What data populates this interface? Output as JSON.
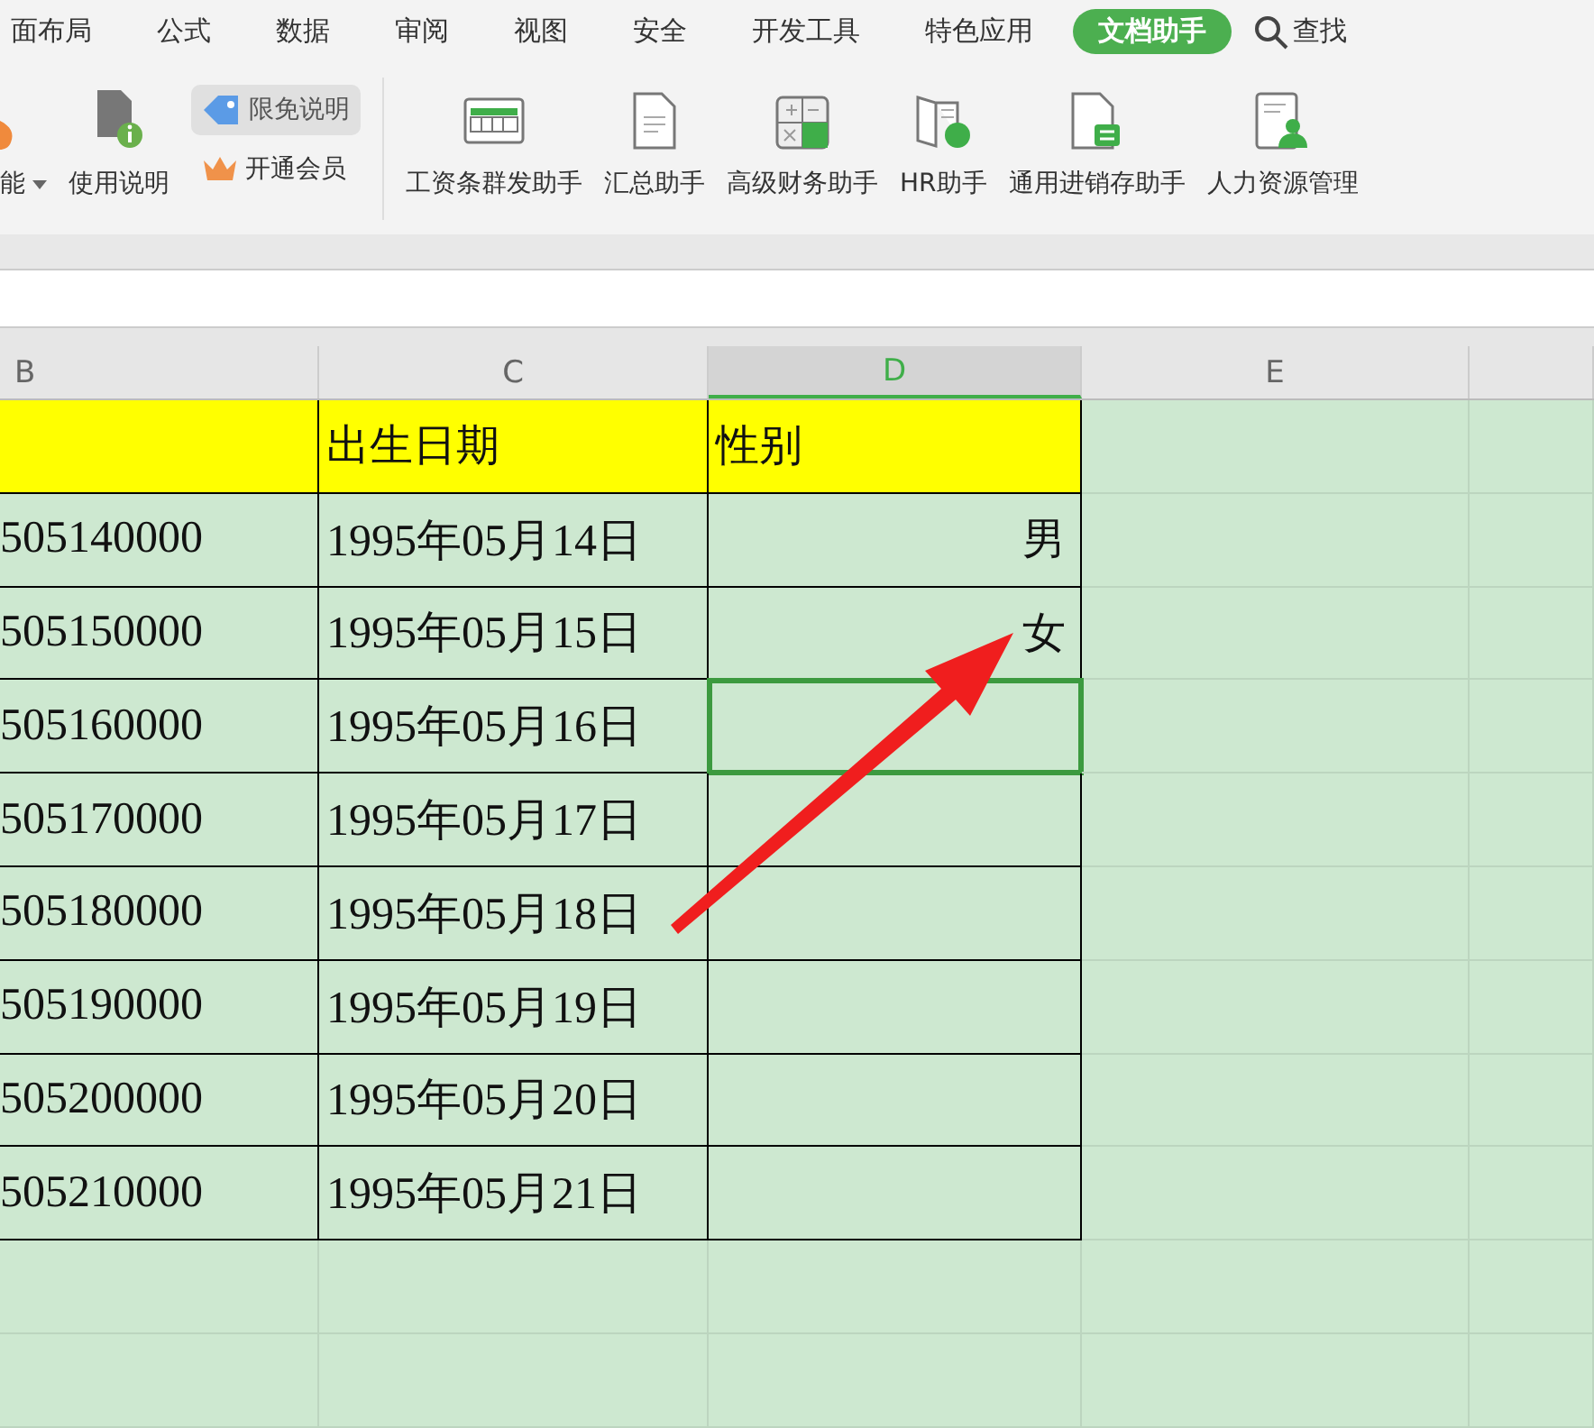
{
  "menu_tabs": [
    {
      "label": "面布局",
      "selected": false
    },
    {
      "label": "公式",
      "selected": false
    },
    {
      "label": "数据",
      "selected": false
    },
    {
      "label": "审阅",
      "selected": false
    },
    {
      "label": "视图",
      "selected": false
    },
    {
      "label": "安全",
      "selected": false
    },
    {
      "label": "开发工具",
      "selected": false
    },
    {
      "label": "特色应用",
      "selected": false
    },
    {
      "label": "文档助手",
      "selected": true
    }
  ],
  "search": {
    "label": "查找"
  },
  "ribbon": {
    "left": [
      {
        "kind": "partial",
        "label": "能"
      },
      {
        "kind": "help",
        "label": "使用说明"
      }
    ],
    "promo": [
      {
        "kind": "tag",
        "label": "限免说明"
      },
      {
        "kind": "crown",
        "label": "开通会员"
      }
    ],
    "tools": [
      {
        "kind": "payslip",
        "label": "工资条群发助手"
      },
      {
        "kind": "summary",
        "label": "汇总助手"
      },
      {
        "kind": "finance",
        "label": "高级财务助手"
      },
      {
        "kind": "hr",
        "label": "HR助手"
      },
      {
        "kind": "inventory",
        "label": "通用进销存助手"
      },
      {
        "kind": "person",
        "label": "人力资源管理"
      }
    ]
  },
  "columns": [
    {
      "label": "B",
      "selected": false
    },
    {
      "label": "C",
      "selected": false
    },
    {
      "label": "D",
      "selected": true
    },
    {
      "label": "E",
      "selected": false
    }
  ],
  "table": {
    "header": {
      "birth_date": "出生日期",
      "gender": "性别"
    },
    "rows": [
      {
        "column_b": "505140000",
        "birth_date": "1995年05月14日",
        "gender": "男",
        "selected": false
      },
      {
        "column_b": "505150000",
        "birth_date": "1995年05月15日",
        "gender": "女",
        "selected": false
      },
      {
        "column_b": "505160000",
        "birth_date": "1995年05月16日",
        "selected": true
      },
      {
        "column_b": "505170000",
        "birth_date": "1995年05月17日",
        "selected": false
      },
      {
        "column_b": "505180000",
        "birth_date": "1995年05月18日",
        "selected": false
      },
      {
        "column_b": "505190000",
        "birth_date": "1995年05月19日",
        "selected": false
      },
      {
        "column_b": "505200000",
        "birth_date": "1995年05月20日",
        "selected": false
      },
      {
        "column_b": "505210000",
        "birth_date": "1995年05月21日",
        "selected": false
      }
    ]
  }
}
